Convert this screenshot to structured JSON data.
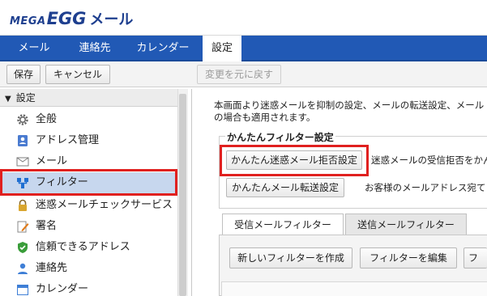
{
  "brand": {
    "mega": "MEGA",
    "egg": "EGG",
    "mail": "メール"
  },
  "nav": {
    "tabs": [
      {
        "label": "メール"
      },
      {
        "label": "連絡先"
      },
      {
        "label": "カレンダー"
      },
      {
        "label": "設定"
      }
    ]
  },
  "toolbar": {
    "save_label": "保存",
    "cancel_label": "キャンセル",
    "revert_label": "変更を元に戻す"
  },
  "sidebar": {
    "header": "設定",
    "items": [
      {
        "label": "全般",
        "icon": "gear-icon"
      },
      {
        "label": "アドレス管理",
        "icon": "address-book-icon"
      },
      {
        "label": "メール",
        "icon": "envelope-icon"
      },
      {
        "label": "フィルター",
        "icon": "filter-icon"
      },
      {
        "label": "迷惑メールチェックサービス",
        "icon": "lock-icon"
      },
      {
        "label": "署名",
        "icon": "pen-icon"
      },
      {
        "label": "信頼できるアドレス",
        "icon": "shield-check-icon"
      },
      {
        "label": "連絡先",
        "icon": "person-icon"
      },
      {
        "label": "カレンダー",
        "icon": "calendar-icon"
      }
    ]
  },
  "main": {
    "description_line1": "本画面より迷惑メールを抑制の設定、メールの転送設定、メール",
    "description_line2": "の場合も適用されます。",
    "easy_filter_title": "かんたんフィルター設定",
    "spam_reject_button": "かんたん迷惑メール拒否設定",
    "spam_reject_desc": "迷惑メールの受信拒否をかん",
    "forward_button": "かんたんメール転送設定",
    "forward_desc": "お客様のメールアドレス宛て",
    "filter_tabs": [
      {
        "label": "受信メールフィルター"
      },
      {
        "label": "送信メールフィルター"
      }
    ],
    "create_filter_button": "新しいフィルターを作成",
    "edit_filter_button": "フィルターを編集",
    "more_button": "フィ"
  },
  "colors": {
    "nav_bg": "#2159b5",
    "highlight": "#e0201f",
    "selected_bg": "#c7d7ee",
    "brand": "#1e3f8f"
  }
}
